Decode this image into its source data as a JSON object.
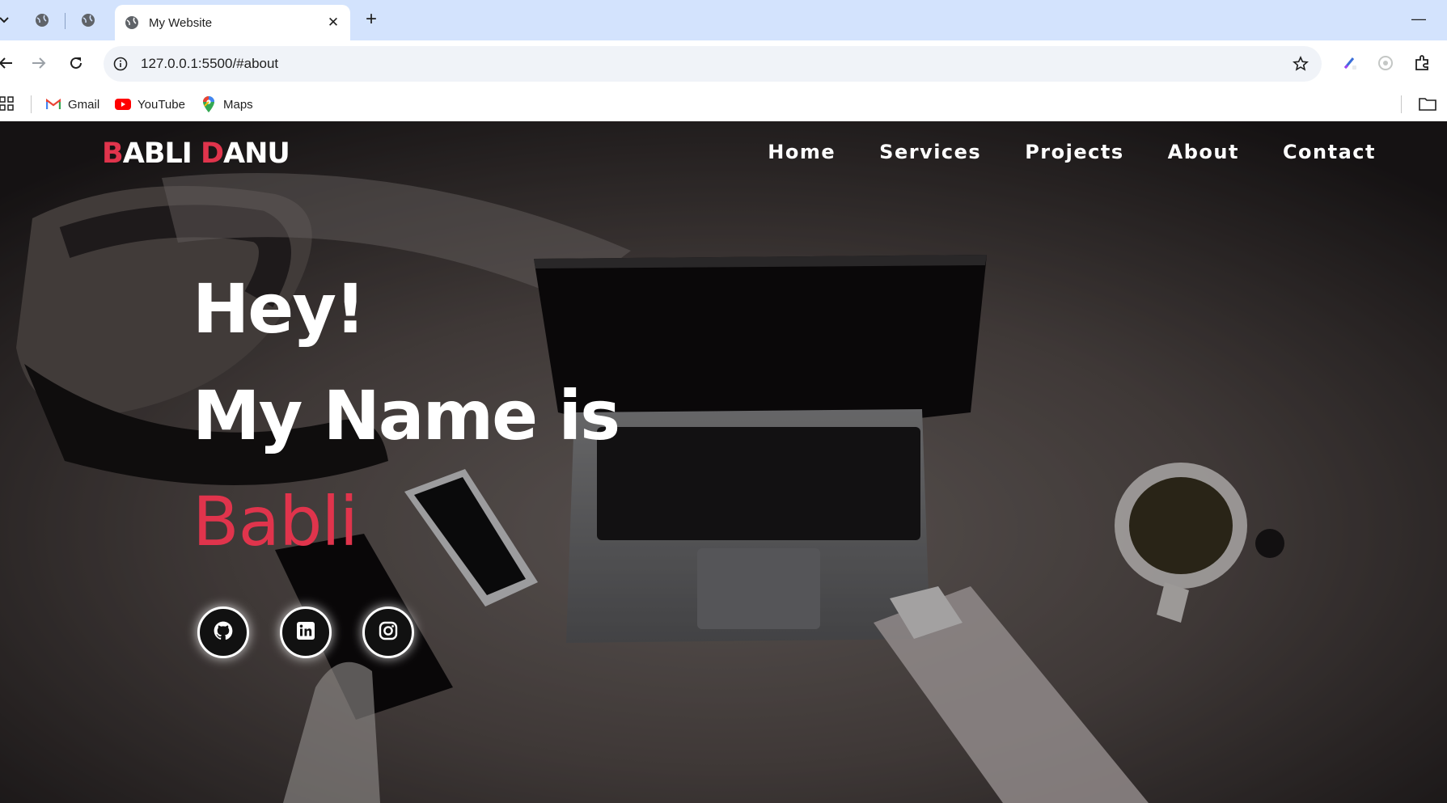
{
  "browser": {
    "tab": {
      "title": "My Website"
    },
    "address": {
      "url": "127.0.0.1:5500/#about"
    },
    "bookmarks": [
      {
        "label": "Gmail",
        "icon": "gmail-icon"
      },
      {
        "label": "YouTube",
        "icon": "youtube-icon"
      },
      {
        "label": "Maps",
        "icon": "maps-icon"
      }
    ]
  },
  "site": {
    "brand": {
      "first_initial": "B",
      "first_rest": "ABLI ",
      "last_initial": "D",
      "last_rest": "ANU"
    },
    "nav": [
      "Home",
      "Services",
      "Projects",
      "About",
      "Contact"
    ],
    "hero": {
      "line1": "Hey!",
      "line2": "My Name is",
      "name": "Babli"
    },
    "social": [
      {
        "icon": "github-icon"
      },
      {
        "icon": "linkedin-icon"
      },
      {
        "icon": "instagram-icon"
      }
    ],
    "colors": {
      "accent": "#e0344c",
      "text": "#ffffff",
      "chrome_tabstrip": "#d3e3fd"
    }
  }
}
